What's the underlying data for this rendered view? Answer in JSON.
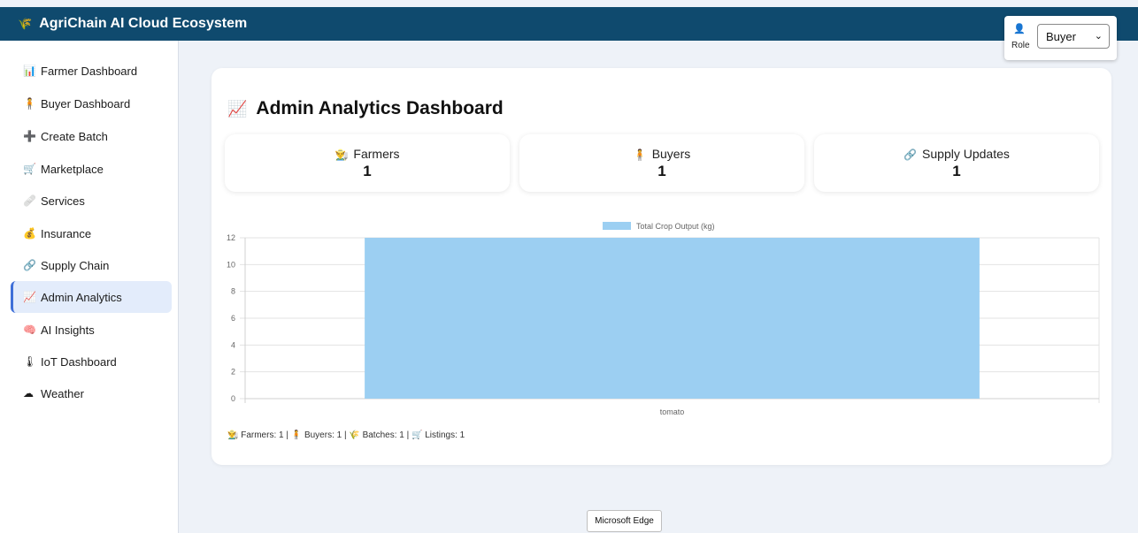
{
  "header": {
    "title": "AgriChain AI Cloud Ecosystem",
    "logo_icon": "sprout-icon"
  },
  "role": {
    "icon": "person-icon",
    "label": "Role",
    "selected": "Buyer"
  },
  "sidebar": {
    "items": [
      {
        "label": "Farmer Dashboard",
        "icon": "bar-chart-icon",
        "glyph": "📊"
      },
      {
        "label": "Buyer Dashboard",
        "icon": "person-icon",
        "glyph": "🧍"
      },
      {
        "label": "Create Batch",
        "icon": "plus-icon",
        "glyph": "➕"
      },
      {
        "label": "Marketplace",
        "icon": "cart-icon",
        "glyph": "🛒"
      },
      {
        "label": "Services",
        "icon": "syringe-icon",
        "glyph": "🩹"
      },
      {
        "label": "Insurance",
        "icon": "money-bag-icon",
        "glyph": "💰"
      },
      {
        "label": "Supply Chain",
        "icon": "link-icon",
        "glyph": "🔗"
      },
      {
        "label": "Admin Analytics",
        "icon": "line-chart-icon",
        "glyph": "📈"
      },
      {
        "label": "AI Insights",
        "icon": "brain-icon",
        "glyph": "🧠"
      },
      {
        "label": "IoT Dashboard",
        "icon": "thermometer-icon",
        "glyph": "🌡"
      },
      {
        "label": "Weather",
        "icon": "cloud-icon",
        "glyph": "☁"
      }
    ],
    "active_index": 7
  },
  "dashboard": {
    "title": "Admin Analytics Dashboard",
    "title_icon": "line-chart-icon",
    "stats": [
      {
        "label": "Farmers",
        "value": "1",
        "icon": "farmer-icon",
        "glyph": "👨‍🌾"
      },
      {
        "label": "Buyers",
        "value": "1",
        "icon": "person-icon",
        "glyph": "🧍"
      },
      {
        "label": "Supply Updates",
        "value": "1",
        "icon": "link-icon",
        "glyph": "🔗"
      }
    ],
    "footer": "👨‍🌾 Farmers: 1 | 🧍 Buyers: 1 | 🌾 Batches: 1 | 🛒 Listings: 1"
  },
  "chart_data": {
    "type": "bar",
    "categories": [
      "tomato"
    ],
    "series": [
      {
        "name": "Total Crop Output (kg)",
        "values": [
          12
        ]
      }
    ],
    "ylim": [
      0,
      12
    ],
    "yticks": [
      0,
      2,
      4,
      6,
      8,
      10,
      12
    ],
    "legend": "top-center",
    "grid": true,
    "bar_color": "#9ccff2",
    "legend_color": "#9ccff2"
  },
  "tooltip": {
    "text": "Microsoft Edge"
  },
  "colors": {
    "header_bg": "#0f4a6e",
    "active_nav_bg": "#e3ecfb",
    "accent": "#3f6fd8"
  }
}
